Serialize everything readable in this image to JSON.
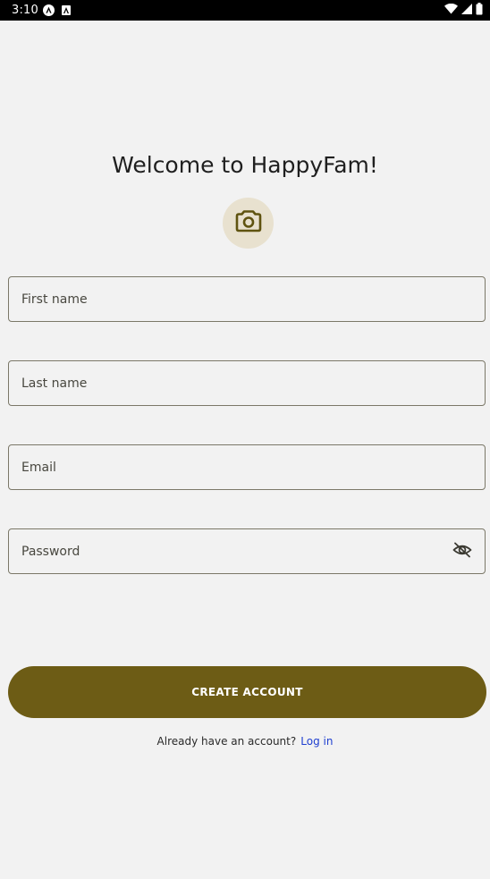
{
  "status_bar": {
    "time": "3:10",
    "notification_icons": [
      "app-a-icon",
      "app-b-icon"
    ],
    "system_icons": [
      "wifi-icon",
      "cellular-signal-icon",
      "battery-icon"
    ]
  },
  "welcome": {
    "title": "Welcome to HappyFam!"
  },
  "avatar": {
    "icon": "camera-icon",
    "background_color": "#e8e1cf",
    "icon_color": "#5f5310"
  },
  "form": {
    "first_name": {
      "placeholder": "First name",
      "value": ""
    },
    "last_name": {
      "placeholder": "Last name",
      "value": ""
    },
    "email": {
      "placeholder": "Email",
      "value": ""
    },
    "password": {
      "placeholder": "Password",
      "value": "",
      "toggle_icon": "eye-off-icon"
    }
  },
  "actions": {
    "create_account_label": "CREATE ACCOUNT",
    "create_account_color": "#6d5c15"
  },
  "login": {
    "prompt": "Already have an account?",
    "link_label": "Log in",
    "link_color": "#1f3fd0"
  }
}
